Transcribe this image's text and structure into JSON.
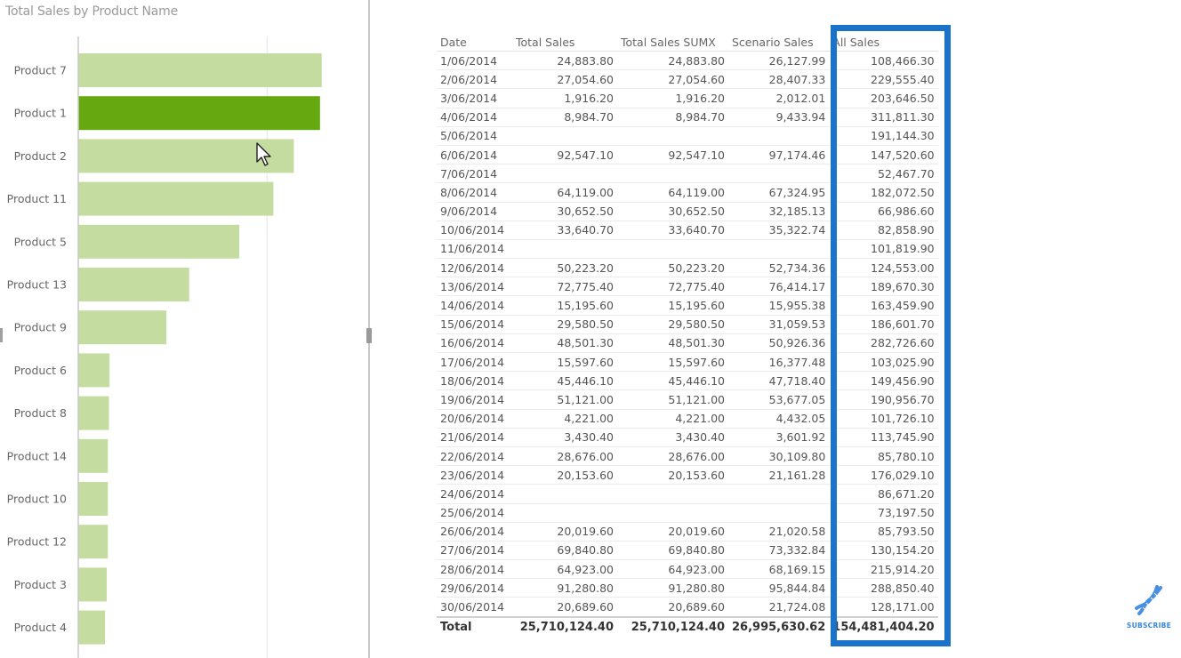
{
  "chart_data": {
    "type": "bar",
    "orientation": "horizontal",
    "title": "Total Sales by Product Name",
    "xlabel": "",
    "ylabel": "",
    "grid": true,
    "xlim": [
      0,
      4800000
    ],
    "gridlines": [
      3320000
    ],
    "highlighted_category": "Product 1",
    "categories": [
      "Product 7",
      "Product 1",
      "Product 2",
      "Product 11",
      "Product 5",
      "Product 13",
      "Product 9",
      "Product 6",
      "Product 8",
      "Product 14",
      "Product 10",
      "Product 12",
      "Product 3",
      "Product 4"
    ],
    "values": [
      4280000,
      4250000,
      3790000,
      3430000,
      2830000,
      1950000,
      1550000,
      550000,
      540000,
      520000,
      520000,
      520000,
      500000,
      470000
    ],
    "colors": {
      "default": "#c4dc9f",
      "highlight": "#66a80f",
      "gridline": "#ececec",
      "axis": "#c8c8c8"
    }
  },
  "table": {
    "columns": [
      "Date",
      "Total Sales",
      "Total Sales SUMX",
      "Scenario Sales",
      "All Sales"
    ],
    "rows": [
      [
        "1/06/2014",
        "24,883.80",
        "24,883.80",
        "26,127.99",
        "108,466.30"
      ],
      [
        "2/06/2014",
        "27,054.60",
        "27,054.60",
        "28,407.33",
        "229,555.40"
      ],
      [
        "3/06/2014",
        "1,916.20",
        "1,916.20",
        "2,012.01",
        "203,646.50"
      ],
      [
        "4/06/2014",
        "8,984.70",
        "8,984.70",
        "9,433.94",
        "311,811.30"
      ],
      [
        "5/06/2014",
        "",
        "",
        "",
        "191,144.30"
      ],
      [
        "6/06/2014",
        "92,547.10",
        "92,547.10",
        "97,174.46",
        "147,520.60"
      ],
      [
        "7/06/2014",
        "",
        "",
        "",
        "52,467.70"
      ],
      [
        "8/06/2014",
        "64,119.00",
        "64,119.00",
        "67,324.95",
        "182,072.50"
      ],
      [
        "9/06/2014",
        "30,652.50",
        "30,652.50",
        "32,185.13",
        "66,986.60"
      ],
      [
        "10/06/2014",
        "33,640.70",
        "33,640.70",
        "35,322.74",
        "82,858.90"
      ],
      [
        "11/06/2014",
        "",
        "",
        "",
        "101,819.90"
      ],
      [
        "12/06/2014",
        "50,223.20",
        "50,223.20",
        "52,734.36",
        "124,553.00"
      ],
      [
        "13/06/2014",
        "72,775.40",
        "72,775.40",
        "76,414.17",
        "189,670.30"
      ],
      [
        "14/06/2014",
        "15,195.60",
        "15,195.60",
        "15,955.38",
        "163,459.90"
      ],
      [
        "15/06/2014",
        "29,580.50",
        "29,580.50",
        "31,059.53",
        "186,601.70"
      ],
      [
        "16/06/2014",
        "48,501.30",
        "48,501.30",
        "50,926.36",
        "282,726.60"
      ],
      [
        "17/06/2014",
        "15,597.60",
        "15,597.60",
        "16,377.48",
        "103,025.90"
      ],
      [
        "18/06/2014",
        "45,446.10",
        "45,446.10",
        "47,718.40",
        "149,456.90"
      ],
      [
        "19/06/2014",
        "51,121.00",
        "51,121.00",
        "53,677.05",
        "190,956.70"
      ],
      [
        "20/06/2014",
        "4,221.00",
        "4,221.00",
        "4,432.05",
        "101,726.10"
      ],
      [
        "21/06/2014",
        "3,430.40",
        "3,430.40",
        "3,601.92",
        "113,745.90"
      ],
      [
        "22/06/2014",
        "28,676.00",
        "28,676.00",
        "30,109.80",
        "85,780.10"
      ],
      [
        "23/06/2014",
        "20,153.60",
        "20,153.60",
        "21,161.28",
        "176,029.10"
      ],
      [
        "24/06/2014",
        "",
        "",
        "",
        "86,671.20"
      ],
      [
        "25/06/2014",
        "",
        "",
        "",
        "73,197.50"
      ],
      [
        "26/06/2014",
        "20,019.60",
        "20,019.60",
        "21,020.58",
        "85,793.50"
      ],
      [
        "27/06/2014",
        "69,840.80",
        "69,840.80",
        "73,332.84",
        "130,154.20"
      ],
      [
        "28/06/2014",
        "64,923.00",
        "64,923.00",
        "68,169.15",
        "215,914.20"
      ],
      [
        "29/06/2014",
        "91,280.80",
        "91,280.80",
        "95,844.84",
        "288,850.40"
      ],
      [
        "30/06/2014",
        "20,689.60",
        "20,689.60",
        "21,724.08",
        "128,171.00"
      ]
    ],
    "total": [
      "Total",
      "25,710,124.40",
      "25,710,124.40",
      "26,995,630.62",
      "154,481,404.20"
    ],
    "highlighted_column": "All Sales",
    "highlight_color": "#1a72c9"
  },
  "overlay": {
    "subscribe_label": "SUBSCRIBE",
    "subscribe_icon": "dna-icon",
    "cursor_icon": "mouse-pointer-icon"
  }
}
